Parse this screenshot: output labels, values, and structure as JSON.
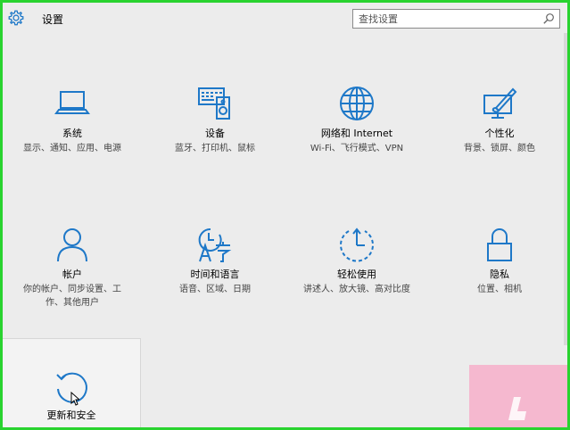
{
  "app": {
    "title": "设置"
  },
  "search": {
    "placeholder": "查找设置"
  },
  "tiles": [
    {
      "label": "系统",
      "desc": "显示、通知、应用、电源",
      "icon": "laptop-icon"
    },
    {
      "label": "设备",
      "desc": "蓝牙、打印机、鼠标",
      "icon": "keyboard-speaker-icon"
    },
    {
      "label": "网络和 Internet",
      "desc": "Wi-Fi、飞行模式、VPN",
      "icon": "globe-icon"
    },
    {
      "label": "个性化",
      "desc": "背景、锁屏、颜色",
      "icon": "paint-monitor-icon"
    },
    {
      "label": "帐户",
      "desc": "你的帐户、同步设置、工作、其他用户",
      "icon": "person-icon"
    },
    {
      "label": "时间和语言",
      "desc": "语音、区域、日期",
      "icon": "time-language-icon"
    },
    {
      "label": "轻松使用",
      "desc": "讲述人、放大镜、高对比度",
      "icon": "ease-of-access-icon"
    },
    {
      "label": "隐私",
      "desc": "位置、相机",
      "icon": "lock-icon"
    },
    {
      "label": "更新和安全",
      "desc": "",
      "icon": "refresh-icon"
    }
  ],
  "colors": {
    "accent": "#1e78c8",
    "frame": "#29d32f",
    "window_bg": "#ececec"
  }
}
